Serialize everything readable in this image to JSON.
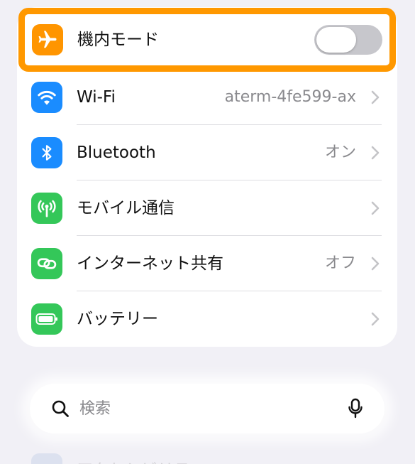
{
  "airplane_mode": {
    "label": "機内モード",
    "icon": "airplane-icon",
    "toggle_on": false,
    "accent": "#ff9500",
    "highlight_color": "#ff9800"
  },
  "rows": [
    {
      "label": "Wi-Fi",
      "value": "aterm-4fe599-ax",
      "icon": "wifi-icon",
      "color": "#1a8cff"
    },
    {
      "label": "Bluetooth",
      "value": "オン",
      "icon": "bluetooth-icon",
      "color": "#1a8cff"
    },
    {
      "label": "モバイル通信",
      "value": "",
      "icon": "cellular-antenna-icon",
      "color": "#34c759"
    },
    {
      "label": "インターネット共有",
      "value": "オフ",
      "icon": "link-icon",
      "color": "#34c759"
    },
    {
      "label": "バッテリー",
      "value": "",
      "icon": "battery-icon",
      "color": "#34c759"
    }
  ],
  "search": {
    "placeholder": "検索",
    "icon": "search-icon",
    "mic_icon": "microphone-icon"
  },
  "faded_next": {
    "label": "アクセシビリティ",
    "icon": "accessibility-icon"
  }
}
